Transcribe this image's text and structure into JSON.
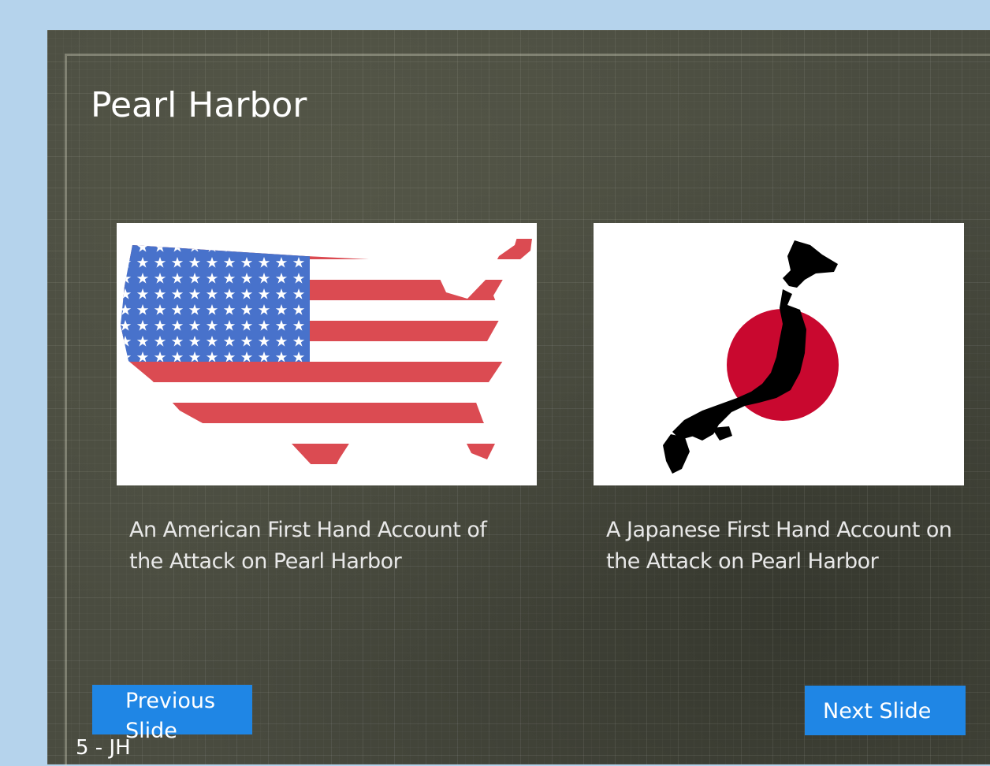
{
  "slide": {
    "title": "Pearl Harbor",
    "cards": [
      {
        "image_icon": "usa-flag-map-icon",
        "caption": "An American First Hand Account of the Attack on Pearl Harbor"
      },
      {
        "image_icon": "japan-flag-map-icon",
        "caption": "A Japanese First Hand Account on the Attack on Pearl Harbor"
      }
    ],
    "nav": {
      "previous_label": "Previous Slide",
      "next_label": "Next Slide"
    },
    "footer": "5 - JH"
  },
  "colors": {
    "page_background": "#b5d3ec",
    "slide_background": "#4a4c40",
    "button": "#1f86e5",
    "flag_red": "#d7333b",
    "flag_blue": "#2f5fc4",
    "japan_red": "#c9082f"
  }
}
